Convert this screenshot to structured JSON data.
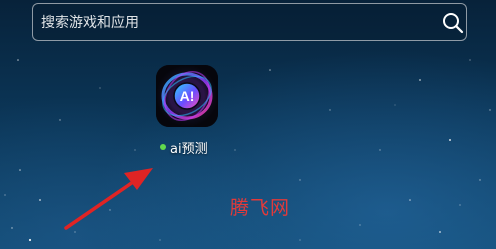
{
  "search": {
    "placeholder": "搜索游戏和应用",
    "value": ""
  },
  "app": {
    "label": "ai预测",
    "icon_text": "A!",
    "status_color": "#62d94d"
  },
  "watermark": {
    "text": "腾飞网"
  },
  "colors": {
    "arrow": "#e02424",
    "watermark": "#e23a3a"
  }
}
